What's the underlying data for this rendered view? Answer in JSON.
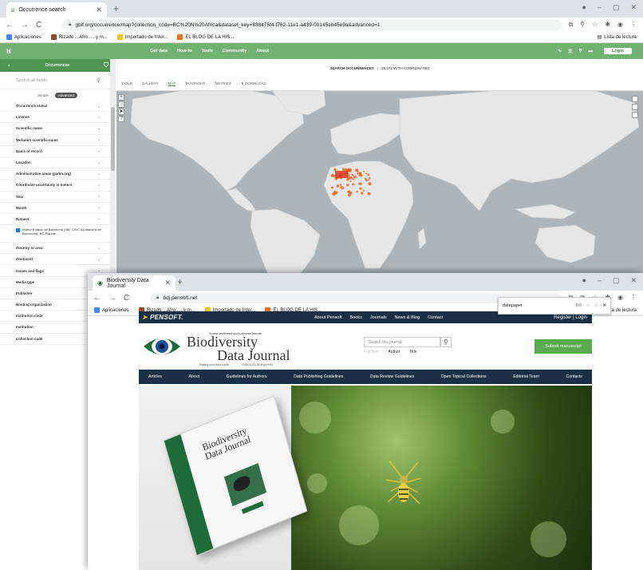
{
  "gbif_window": {
    "tab": {
      "title": "Occurrence search"
    },
    "url": "gbif.org/occurrence/map?collection_code=BC%20N%20Africa&dataset_key=838475f4-f762-11e1-a439-00145eb45e9a&advanced=1",
    "bookmarks": [
      {
        "label": "Aplicaciones",
        "color": "#4285f4"
      },
      {
        "label": "Rizado ...Afro......y m...",
        "color": "#8d4b2d"
      },
      {
        "label": "Importado de Inter...",
        "color": "#f4c20d"
      },
      {
        "label": "EL BLOG DE LA HIS...",
        "color": "#e8711a"
      }
    ],
    "reading_list": "Lista de lectura",
    "topnav": [
      "Get data",
      "How-to",
      "Tools",
      "Community",
      "About"
    ],
    "login": "Login",
    "sidebar": {
      "title": "Occurrences",
      "search_placeholder": "Search all fields",
      "mode_simple": "Simple",
      "mode_advanced": "Advanced",
      "items_top": [
        "Occurrence status",
        "License",
        "Scientific name",
        "Verbatim scientific name",
        "Basis of record",
        "Location",
        "Administrative areas (gadm.org)",
        "Coordinate uncertainty in meters",
        "Year",
        "Month",
        "Dataset"
      ],
      "dataset_selected": "Institut Botànic de Barcelona (IBB, CSIC-Ajuntament de Barcelona): BC-Plantae",
      "items_bottom": [
        "Country or area",
        "Continent",
        "Issues and flags",
        "Media type",
        "Publisher",
        "Hosting organization",
        "Institution code",
        "Institution",
        "Collection code"
      ]
    },
    "map_header": {
      "left": "SEARCH OCCURRENCES",
      "sep": "|",
      "right": "28,672 WITH COORDINATES"
    },
    "map_tabs": [
      "TABLE",
      "GALLERY",
      "MAP",
      "TAXONOMY",
      "METRICS",
      "⬇ DOWNLOAD"
    ],
    "map_active_tab": "MAP",
    "land_color": "#e6e6e6",
    "ocean_color": "#aeb4b8",
    "point_color": "#e8641e"
  },
  "bdj_window": {
    "tab": {
      "title": "Biodiversity Data Journal"
    },
    "url": "bdj.pensoft.net",
    "bookmarks": [
      {
        "label": "Aplicaciones",
        "color": "#4285f4"
      },
      {
        "label": "Rizado ...Afro......y m...",
        "color": "#8d4b2d"
      },
      {
        "label": "Importado de Inter...",
        "color": "#f4c20d"
      },
      {
        "label": "EL BLOG DE LA HIS...",
        "color": "#e8711a"
      }
    ],
    "reading_list": "Lista de lectura",
    "find": {
      "query": "datapaper",
      "count": "0/0"
    },
    "pensoft": "PENSOFT.",
    "topnav": [
      "About Pensoft",
      "Books",
      "Journals",
      "News & Blog",
      "Contact"
    ],
    "register_login": "Register | Login",
    "logo": {
      "small": "A peer-reviewed open-access journal",
      "line1": "Biodiversity",
      "line2": "Data Journal",
      "tagline1": "Making your data count!",
      "tagline2": "ISSN 1314-2828 (online)"
    },
    "search_placeholder": "Search this journal",
    "filters": [
      "Full Text",
      "Author",
      "Title"
    ],
    "submit": "Submit manuscript",
    "nav": [
      "Articles",
      "About",
      "Guidelines for Authors",
      "Data Publishing Guidelines",
      "Data Review Guidelines",
      "Open Topical Collections",
      "Editorial Team",
      "Contacts"
    ],
    "cover": {
      "line1": "Biodiversity",
      "line2": "Data Journal"
    },
    "brand_dark": "#1a3047",
    "brand_green": "#5aaa50"
  }
}
